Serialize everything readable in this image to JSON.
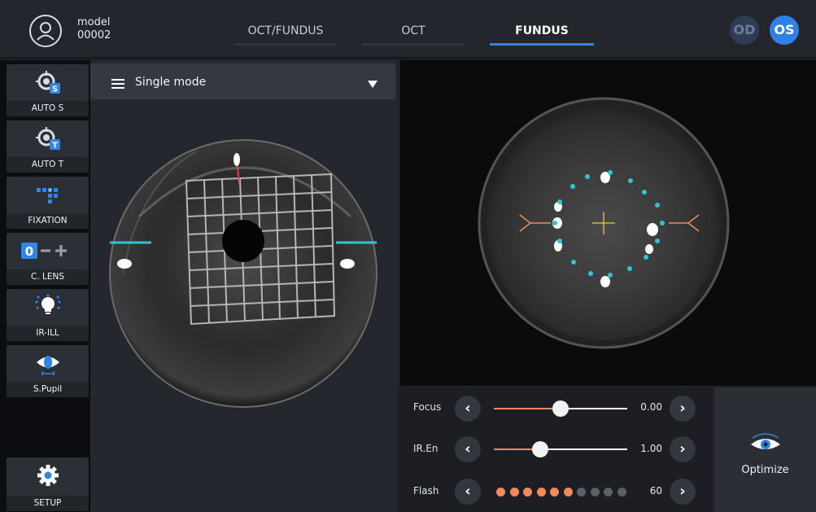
{
  "header": {
    "user_label": "model",
    "user_id": "00002",
    "tabs": [
      {
        "label": "OCT/FUNDUS",
        "active": false
      },
      {
        "label": "OCT",
        "active": false
      },
      {
        "label": "FUNDUS",
        "active": true
      }
    ],
    "eye_od": "OD",
    "eye_os": "OS",
    "selected_eye": "OS"
  },
  "sidebar": {
    "items": [
      {
        "label": "AUTO S",
        "icon": "target-s-icon"
      },
      {
        "label": "AUTO T",
        "icon": "target-t-icon"
      },
      {
        "label": "FIXATION",
        "icon": "fixation-grid-icon"
      },
      {
        "label": "C. LENS",
        "icon": "lens-toggle-icon"
      },
      {
        "label": "IR-ILL",
        "icon": "bulb-icon"
      },
      {
        "label": "S.Pupil",
        "icon": "eye-pupil-icon"
      }
    ],
    "setup_label": "SETUP"
  },
  "mode": {
    "selected": "Single mode"
  },
  "controls": {
    "focus": {
      "label": "Focus",
      "value": "0.00",
      "position": 0.5
    },
    "iren": {
      "label": "IR.En",
      "value": "1.00",
      "position": 0.35
    },
    "flash": {
      "label": "Flash",
      "value": "60",
      "level": 6,
      "max": 10
    }
  },
  "optimize": {
    "label": "Optimize"
  },
  "colors": {
    "accent": "#2e86e6",
    "orange": "#f08a5d",
    "cyan": "#2ec4d6"
  }
}
